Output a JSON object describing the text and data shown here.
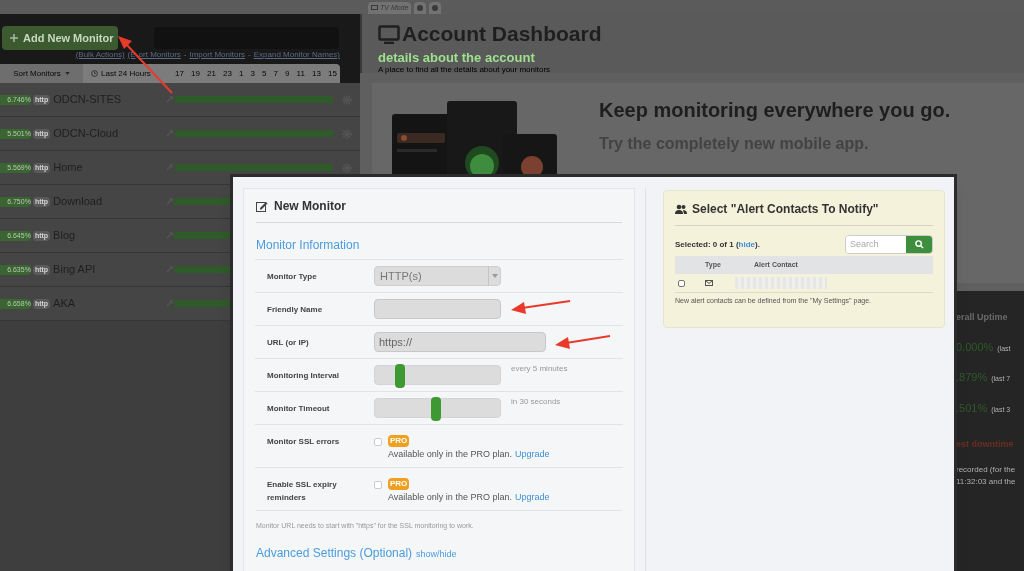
{
  "top_tabs": [
    {
      "label": "TV Mode"
    }
  ],
  "sidebar": {
    "add_button": "Add New Monitor",
    "links": [
      "(Bulk Actions)",
      "(E",
      "ort Monitors",
      "-",
      "Import Monitors",
      "-",
      "Expand Monitor Names)"
    ],
    "sort_button": "Sort Monitors",
    "period": "Last 24 Hours",
    "hours": [
      "17",
      "19",
      "21",
      "23",
      "1",
      "3",
      "5",
      "7",
      "9",
      "11",
      "13",
      "15"
    ],
    "monitors": [
      {
        "uptime": "6.746%",
        "type": "http",
        "name": "ODCN-SITES"
      },
      {
        "uptime": "5.501%",
        "type": "http",
        "name": "ODCN-Cloud"
      },
      {
        "uptime": "5.569%",
        "type": "http",
        "name": "Home"
      },
      {
        "uptime": "6.750%",
        "type": "http",
        "name": "Download"
      },
      {
        "uptime": "6.645%",
        "type": "http",
        "name": "Blog"
      },
      {
        "uptime": "6.635%",
        "type": "http",
        "name": "Bing API"
      },
      {
        "uptime": "6.658%",
        "type": "http",
        "name": "AKA"
      }
    ]
  },
  "dashboard": {
    "title": "Account Dashboard",
    "subtitle": "details about the account",
    "description": "A place to find all the details about your monitors",
    "promo_title": "Keep monitoring everywhere you go.",
    "promo_subtitle": "Try the completely new mobile app."
  },
  "uptime_panel": {
    "header": "erall Uptime",
    "rows": [
      {
        "value": "0.000%",
        "period": "(last"
      },
      {
        "value": ".879%",
        "period": "(last 7"
      },
      {
        "value": ".501%",
        "period": "(last 3"
      }
    ],
    "downtime_header": "est downtime",
    "downtime_lines": [
      "recorded (for the",
      "11:32:03 and the"
    ]
  },
  "modal": {
    "title": "New Monitor",
    "section": "Monitor Information",
    "fields": [
      {
        "kind": "select",
        "label": "Monitor Type",
        "value": "HTTP(s)"
      },
      {
        "kind": "text",
        "label": "Friendly Name"
      },
      {
        "kind": "text",
        "label": "URL (or IP)",
        "value": "https://"
      },
      {
        "kind": "slider",
        "label": "Monitoring Interval",
        "level": 0.2,
        "reading": "every 5 minutes"
      },
      {
        "kind": "slider",
        "label": "Monitor Timeout",
        "level": 0.49,
        "reading": "in 30 seconds"
      },
      {
        "kind": "pro",
        "label": "Monitor SSL errors",
        "checked": false,
        "badge": "PRO",
        "note": "Available only in the PRO plan.",
        "link": "Upgrade"
      },
      {
        "kind": "pro",
        "label": "Enable SSL expiry reminders",
        "checked": false,
        "badge": "PRO",
        "note": "Available only in the PRO plan.",
        "link": "Upgrade"
      }
    ],
    "ssl_note": "Monitor URL needs to start with \"https\" for the SSL monitoring to work.",
    "advanced": "Advanced Settings (Optional)",
    "advanced_link": "show/hide",
    "alerts": {
      "title": "Select \"Alert Contacts To Notify\"",
      "selected_prefix": "Selected: 0 of 1 (",
      "hide_link": "hide",
      "selected_suffix": ").",
      "search_placeholder": "Search",
      "columns": [
        "Type",
        "Alert Contact"
      ],
      "contacts": [
        {
          "checked": false,
          "kind": "email"
        }
      ],
      "footer": "New alert contacts can be defined from the \"My Settings\" page."
    }
  }
}
